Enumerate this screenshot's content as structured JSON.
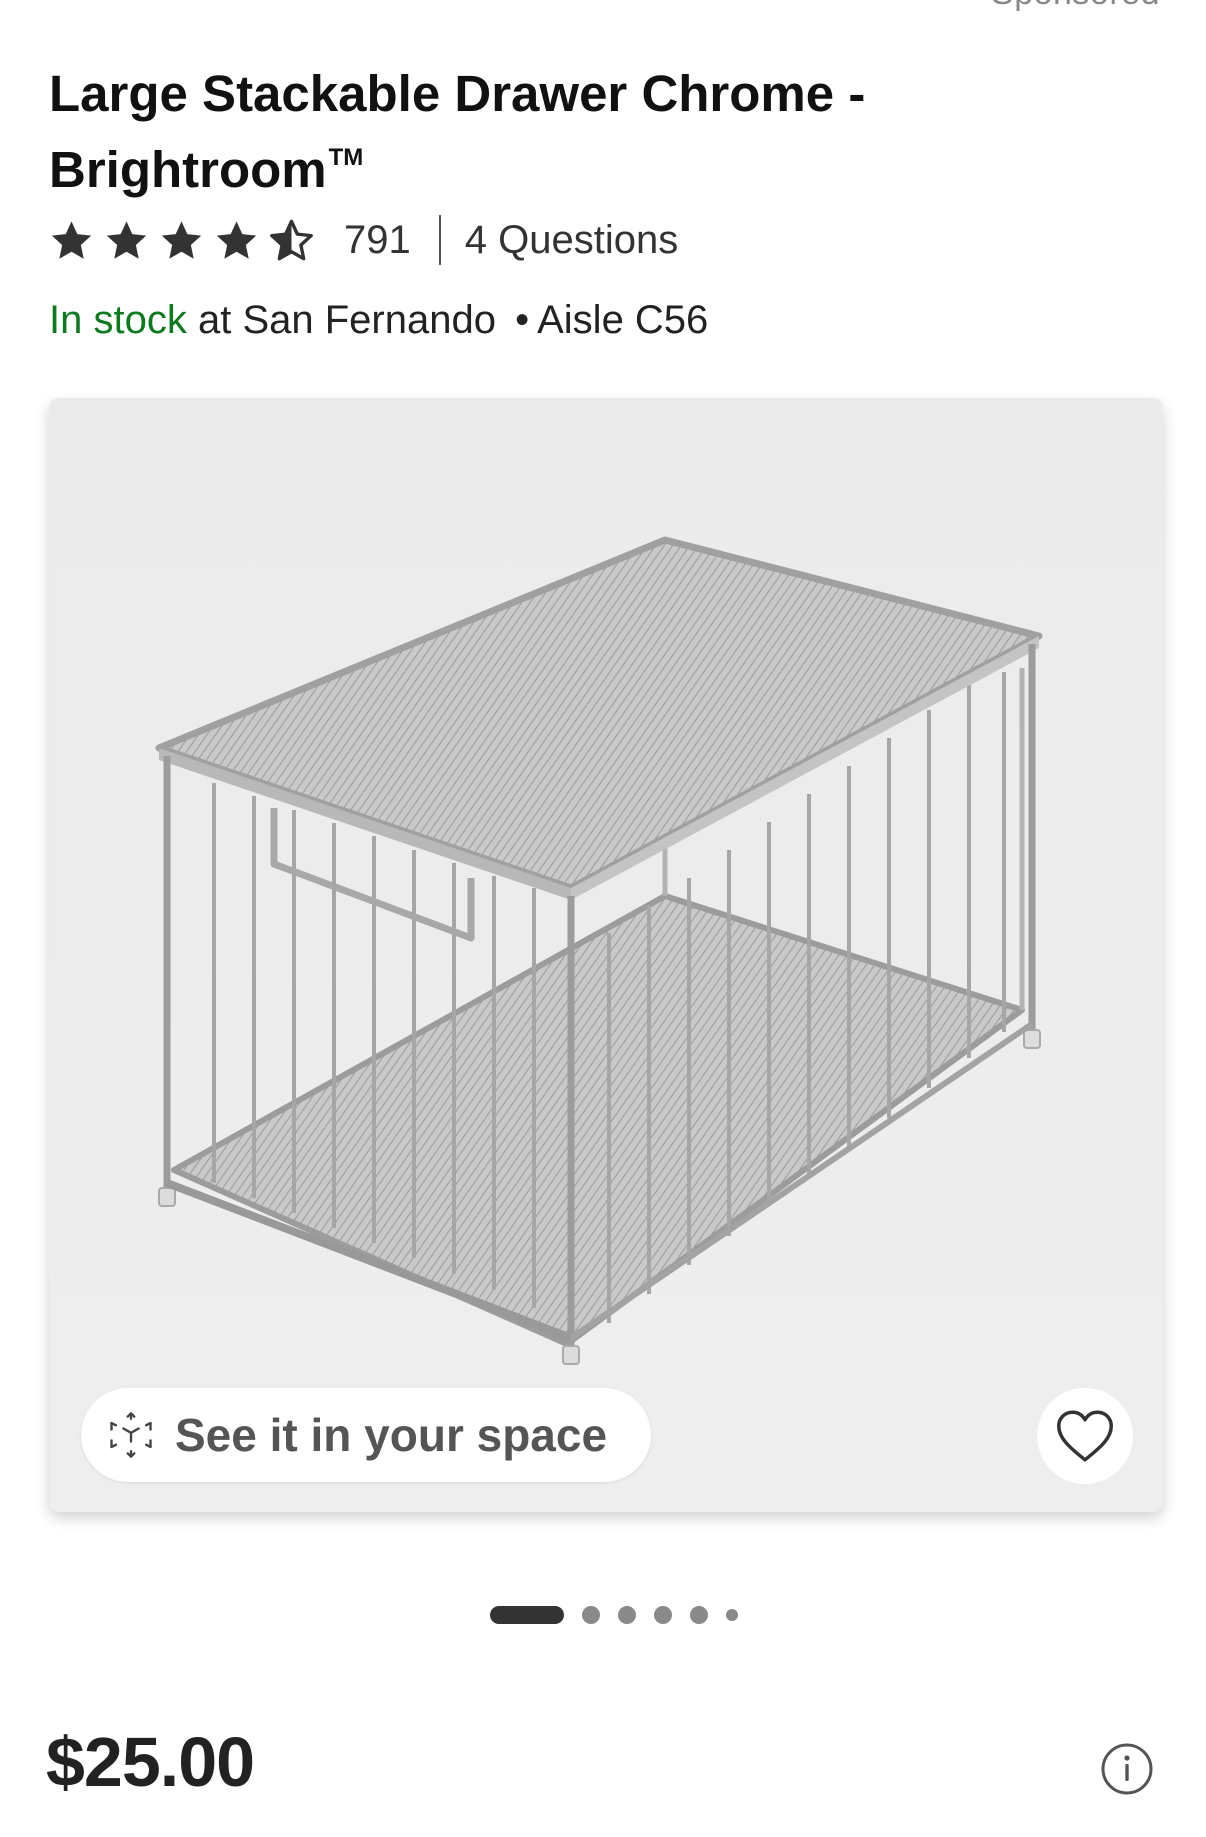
{
  "header": {
    "sponsored_label": "Sponsored"
  },
  "product": {
    "title": "Large Stackable Drawer Chrome - Brightroom",
    "trademark": "TM",
    "rating": {
      "stars": 4.5,
      "max_stars": 5,
      "review_count": "791",
      "questions_label": "4 Questions"
    },
    "availability": {
      "status": "In stock",
      "store_text": "at San Fernando",
      "separator": "•",
      "aisle": "Aisle C56",
      "status_color": "#0c7a1f"
    },
    "price": "$25.00"
  },
  "gallery": {
    "ar_button_label": "See it in your space",
    "ar_icon": "ar-cube-icon",
    "favorite_icon": "heart-outline-icon",
    "image_count": 6,
    "active_index": 0,
    "background_color": "#ececec"
  },
  "icons": {
    "star_color": "#333333",
    "info": "info-icon"
  }
}
